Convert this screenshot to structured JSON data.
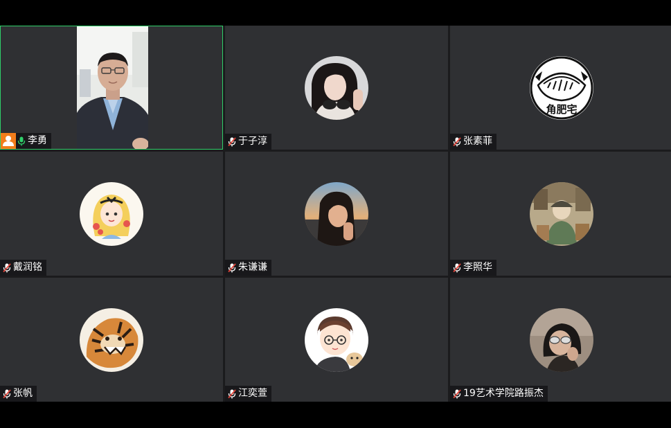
{
  "meeting": {
    "participants": [
      {
        "name": "李勇",
        "host": true,
        "mic": "on",
        "video": true
      },
      {
        "name": "于子淳",
        "mic": "muted",
        "avatar": "girl-headphones-avatar"
      },
      {
        "name": "张素菲",
        "mic": "muted",
        "avatar": "gyoza-logo-avatar",
        "avatar_text": "角肥宅"
      },
      {
        "name": "戴润铭",
        "mic": "muted",
        "avatar": "cartoon-alice-avatar"
      },
      {
        "name": "朱谦谦",
        "mic": "muted",
        "avatar": "girl-sunset-avatar"
      },
      {
        "name": "李照华",
        "mic": "muted",
        "avatar": "illustration-avatar"
      },
      {
        "name": "张帆",
        "mic": "muted",
        "avatar": "tiger-illustration-avatar"
      },
      {
        "name": "江奕萱",
        "mic": "muted",
        "avatar": "cartoon-boy-avatar"
      },
      {
        "name": "19艺术学院路振杰",
        "mic": "muted",
        "avatar": "person-glasses-avatar"
      }
    ]
  },
  "colors": {
    "tile_bg": "#2f3033",
    "active_border": "#2fd06a",
    "host_badge": "#f27d1a",
    "mic_on": "#2fd06a",
    "mic_muted": "#e0443a"
  }
}
